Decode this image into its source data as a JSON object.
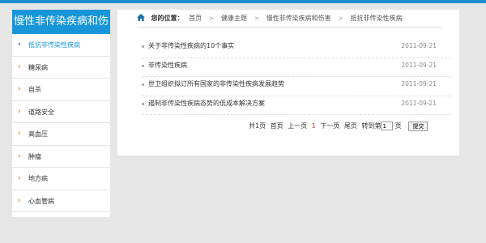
{
  "sidebar": {
    "title": "慢性非传染疾病和伤",
    "items": [
      {
        "label": "抵抗非传染性疾病"
      },
      {
        "label": "糖尿病"
      },
      {
        "label": "自杀"
      },
      {
        "label": "道路安全"
      },
      {
        "label": "高血压"
      },
      {
        "label": "肿瘤"
      },
      {
        "label": "地方病"
      },
      {
        "label": "心血管病"
      }
    ]
  },
  "breadcrumb": {
    "label": "您的位置：",
    "items": [
      "首页",
      "健康主题",
      "慢性非传染疾病和伤害",
      "抵抗非传染性疾病"
    ]
  },
  "articles": [
    {
      "title": "关于非传染性疾病的10个事实",
      "date": "2011-09-21"
    },
    {
      "title": "非传染性疾病",
      "date": "2011-09-21"
    },
    {
      "title": "世卫组织拟订所有国家的非传染性疾病发展趋势",
      "date": "2011-09-21"
    },
    {
      "title": "遏制非传染性疾病态势的低成本解决方案",
      "date": "2011-09-21"
    }
  ],
  "pager": {
    "total": "共1页",
    "first": "首页",
    "prev": "上一页",
    "current": "1",
    "next": "下一页",
    "last": "尾页",
    "goto_label": "转到第",
    "page_value": "1",
    "page_suffix": "页",
    "submit_label": "提交"
  },
  "colors": {
    "accent": "#1696d8",
    "chevron": "#e08a1a",
    "current_page": "#dd3333"
  }
}
